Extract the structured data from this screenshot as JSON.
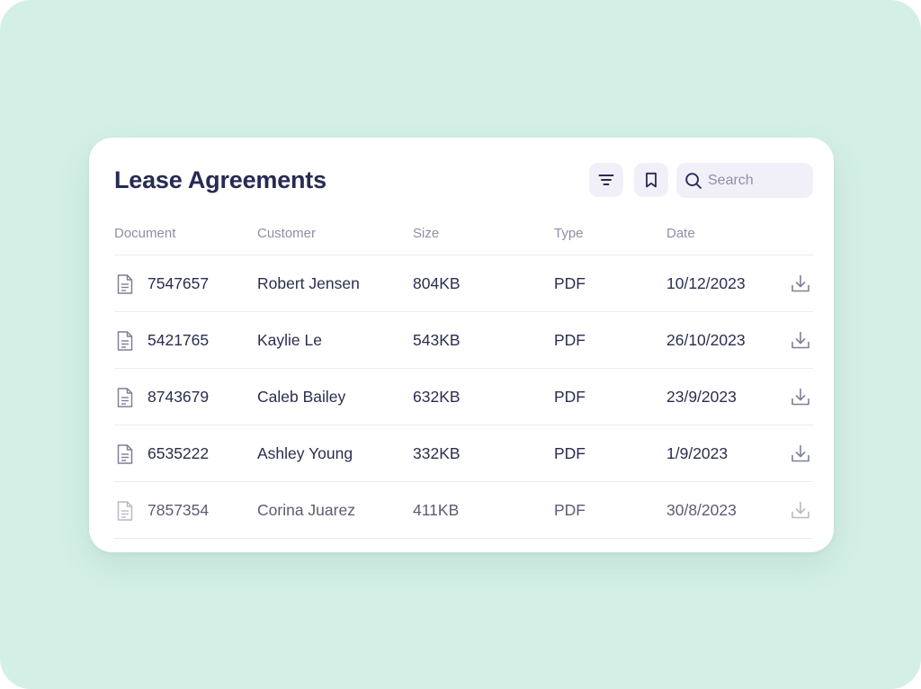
{
  "card": {
    "title": "Lease Agreements",
    "search": {
      "placeholder": "Search"
    }
  },
  "icons": {
    "filter": "filter-icon",
    "bookmark": "bookmark-icon",
    "search": "search-icon",
    "document": "document-icon",
    "download": "download-icon"
  },
  "colors": {
    "background": "#d4f0e6",
    "card": "#ffffff",
    "title": "#262b53",
    "button_bg": "#f1f0f9",
    "header_text": "#8d8fa5",
    "cell_text": "#2a2e4f"
  },
  "table": {
    "columns": [
      "Document",
      "Customer",
      "Size",
      "Type",
      "Date"
    ],
    "rows": [
      {
        "document": "7547657",
        "customer": "Robert Jensen",
        "size": "804KB",
        "type": "PDF",
        "date": "10/12/2023"
      },
      {
        "document": "5421765",
        "customer": "Kaylie Le",
        "size": "543KB",
        "type": "PDF",
        "date": "26/10/2023"
      },
      {
        "document": "8743679",
        "customer": "Caleb Bailey",
        "size": "632KB",
        "type": "PDF",
        "date": "23/9/2023"
      },
      {
        "document": "6535222",
        "customer": "Ashley Young",
        "size": "332KB",
        "type": "PDF",
        "date": "1/9/2023"
      },
      {
        "document": "7857354",
        "customer": "Corina Juarez",
        "size": "411KB",
        "type": "PDF",
        "date": "30/8/2023"
      }
    ]
  }
}
